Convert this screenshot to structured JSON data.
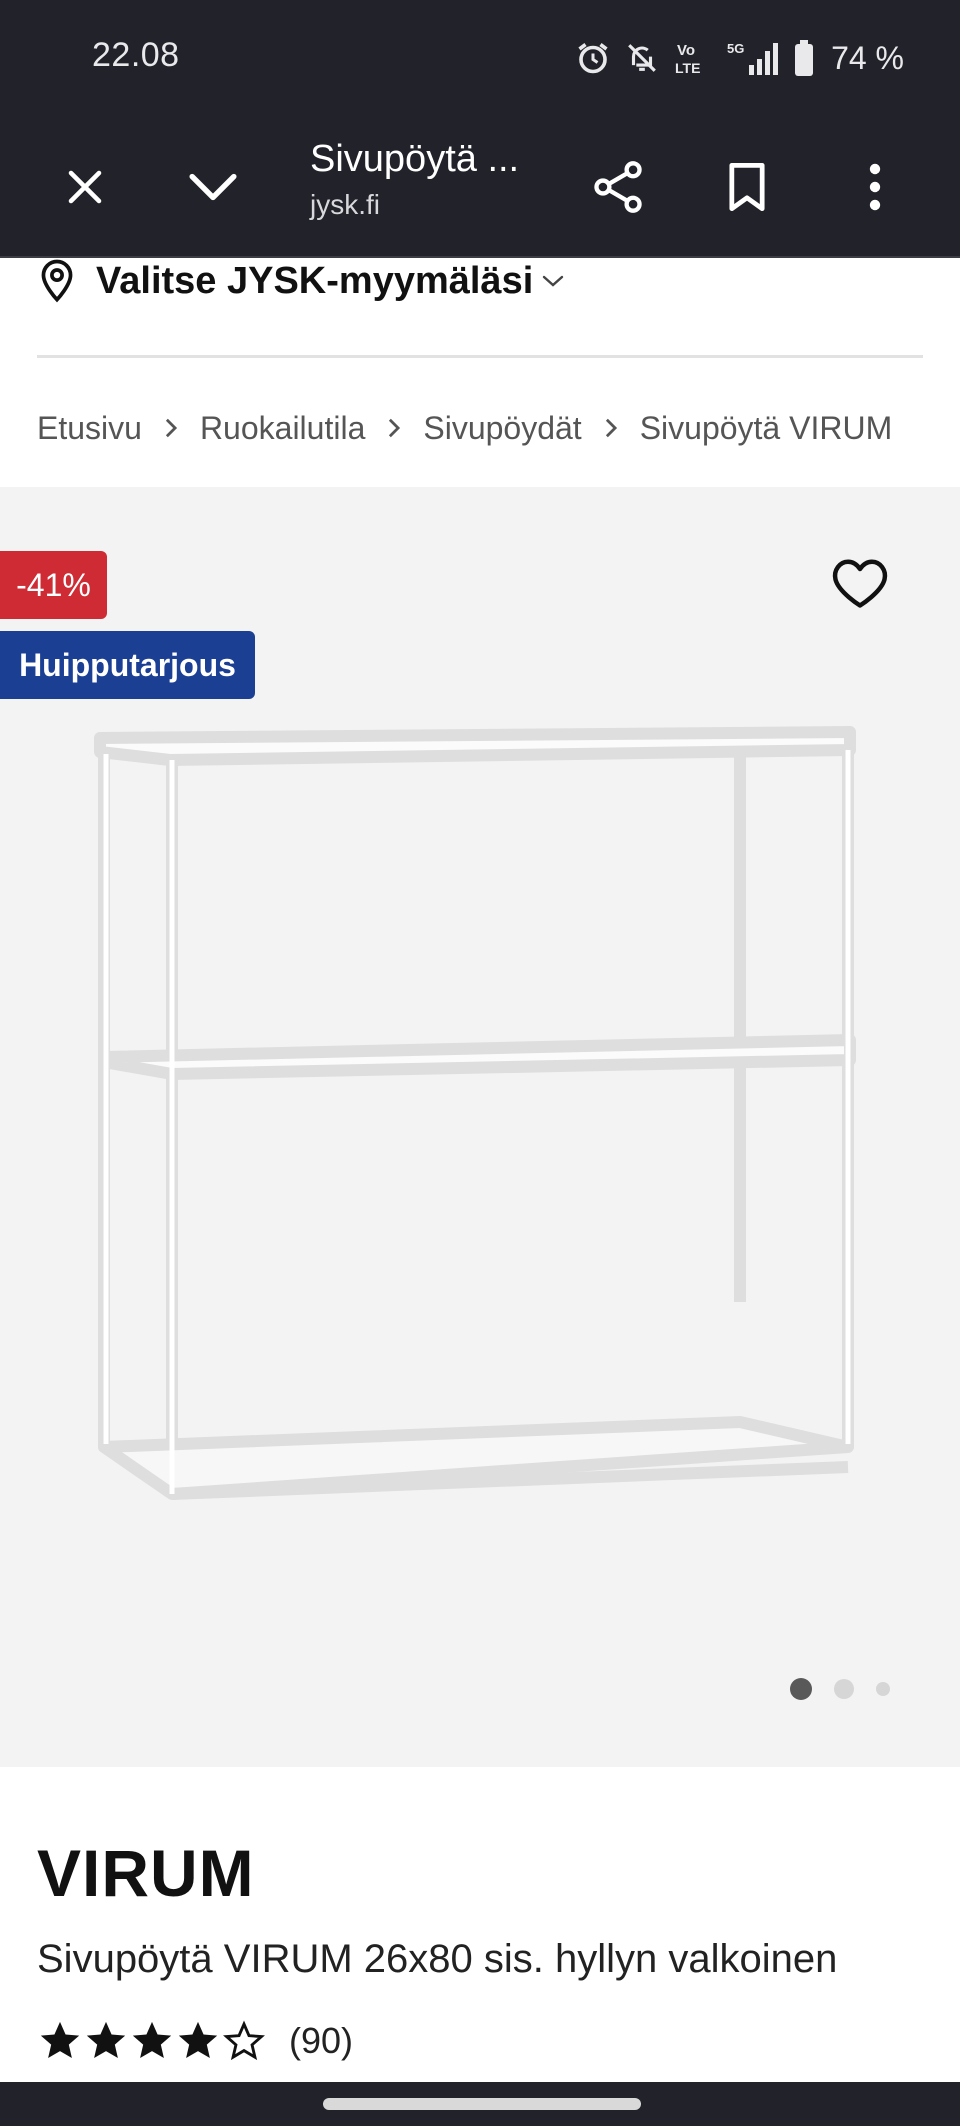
{
  "status_bar": {
    "time": "22.08",
    "battery": "74 %",
    "icons": [
      "alarm-icon",
      "mute-bell-icon",
      "volte-icon",
      "5g-signal-icon",
      "battery-icon"
    ]
  },
  "toolbar": {
    "title": "Sivupöytä ...",
    "domain": "jysk.fi",
    "icons": [
      "close-icon",
      "chevron-down-icon",
      "share-icon",
      "bookmark-icon",
      "more-vert-icon"
    ]
  },
  "store": {
    "label": "Valitse JYSK-myymäläsi"
  },
  "breadcrumb": [
    "Etusivu",
    "Ruokailutila",
    "Sivupöydät",
    "Sivupöytä VIRUM"
  ],
  "gallery": {
    "discount_badge": "-41%",
    "deal_badge": "Huipputarjous",
    "image_count": 3,
    "active_image": 1,
    "colors": {
      "discount": "#cf2b35",
      "deal": "#1b3f93"
    }
  },
  "product": {
    "brand": "VIRUM",
    "name": "Sivupöytä VIRUM 26x80 sis. hyllyn valkoinen",
    "rating_stars": 4,
    "rating_max": 5,
    "review_count": "(90)"
  }
}
